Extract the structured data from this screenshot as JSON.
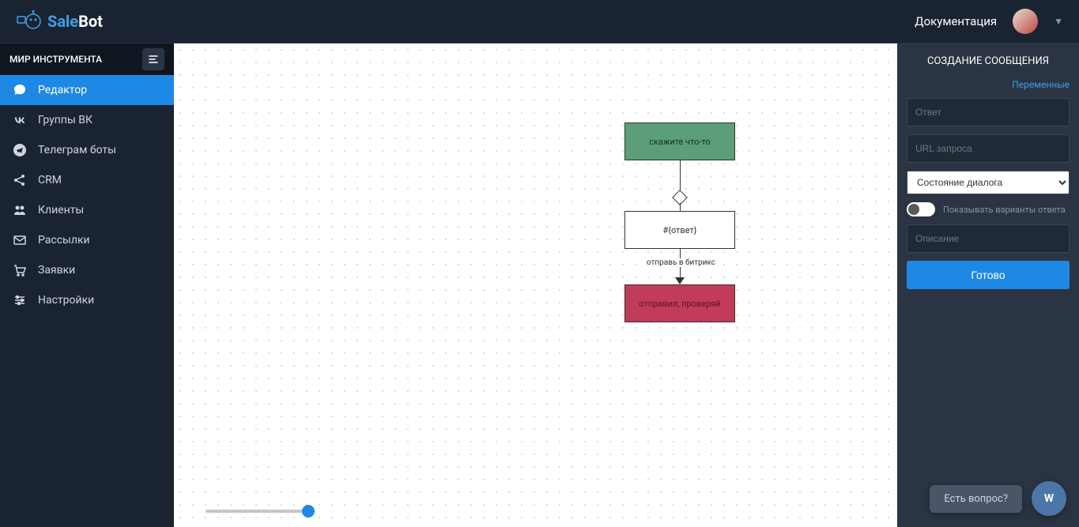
{
  "header": {
    "logo_sale": "Sale",
    "logo_bot": "Bot",
    "documentation": "Документация"
  },
  "sidebar": {
    "project_name": "МИР ИНСТРУМЕНТА",
    "items": [
      {
        "label": "Редактор",
        "icon": "chat"
      },
      {
        "label": "Группы ВК",
        "icon": "vk"
      },
      {
        "label": "Телеграм боты",
        "icon": "telegram"
      },
      {
        "label": "CRM",
        "icon": "share"
      },
      {
        "label": "Клиенты",
        "icon": "users"
      },
      {
        "label": "Рассылки",
        "icon": "envelope"
      },
      {
        "label": "Заявки",
        "icon": "cart"
      },
      {
        "label": "Настройки",
        "icon": "sliders"
      }
    ]
  },
  "canvas": {
    "nodes": {
      "n1": "скажите что-то",
      "n2": "#{ответ}",
      "n3": "отправил, проверяй"
    },
    "edge_label": "отправь в битрикс"
  },
  "right_panel": {
    "title": "СОЗДАНИЕ СООБЩЕНИЯ",
    "variables_link": "Переменные",
    "answer_placeholder": "Ответ",
    "url_placeholder": "URL запроса",
    "dialog_state": "Состояние диалога",
    "show_variants": "Показывать варианты ответа",
    "description_placeholder": "Описание",
    "done_button": "Готово"
  },
  "chat_widget": "Есть вопрос?",
  "vk_widget": "W"
}
